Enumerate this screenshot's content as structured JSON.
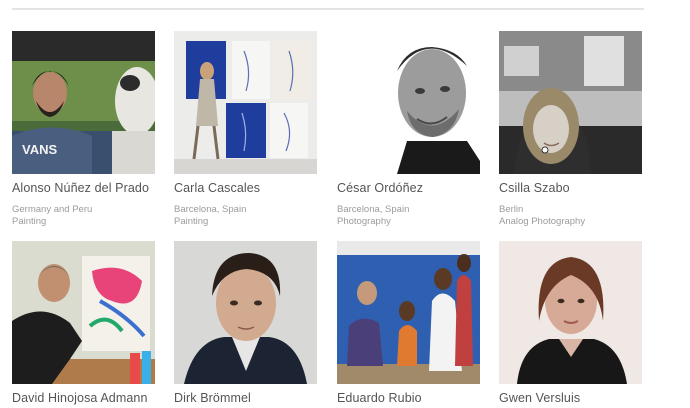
{
  "artists": [
    {
      "name": "Alonso Núñez del Prado",
      "location": "Germany and Peru",
      "discipline": "Painting",
      "shirt_text": "VANS"
    },
    {
      "name": "Carla Cascales",
      "location": "Barcelona, Spain",
      "discipline": "Painting"
    },
    {
      "name": "César Ordóñez",
      "location": "Barcelona, Spain",
      "discipline": "Photography"
    },
    {
      "name": "Csilla Szabo",
      "location": "Berlin",
      "discipline": "Analog Photography"
    },
    {
      "name": "David Hinojosa Admann"
    },
    {
      "name": "Dirk Brömmel"
    },
    {
      "name": "Eduardo Rubio"
    },
    {
      "name": "Gwen Versluis"
    }
  ]
}
